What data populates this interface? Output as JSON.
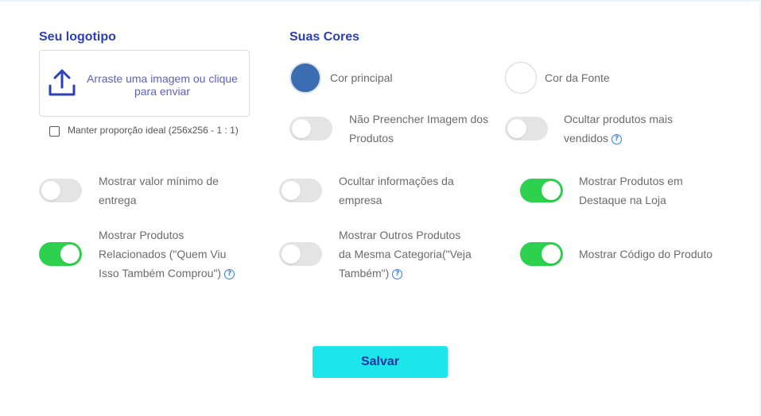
{
  "logo": {
    "heading": "Seu logotipo",
    "upload_text": "Arraste uma imagem ou clique para enviar",
    "keep_ratio_label": "Manter proporção ideal (256x256 - 1 : 1)",
    "keep_ratio_checked": false
  },
  "colors": {
    "heading": "Suas Cores",
    "main_label": "Cor principal",
    "main_color": "#3b6db3",
    "font_label": "Cor da Fonte",
    "font_color": "#ffffff"
  },
  "toggles": {
    "nao_preencher": {
      "line1": "Não Preencher Imagem dos",
      "line2": "Produtos",
      "on": false
    },
    "ocultar_mais_vendidos": {
      "line1": "Ocultar produtos mais",
      "line2": "vendidos",
      "on": false
    },
    "valor_minimo": {
      "line1": "Mostrar valor mínimo de",
      "line2": "entrega",
      "on": false
    },
    "ocultar_empresa": {
      "line1": "Ocultar informações da",
      "line2": "empresa",
      "on": false
    },
    "destaque": {
      "line1": "Mostrar Produtos em",
      "line2": "Destaque na Loja",
      "on": true
    },
    "relacionados": {
      "line1": "Mostrar Produtos",
      "line2": "Relacionados (\"Quem Viu",
      "line3": "Isso Também Comprou\")",
      "on": true
    },
    "outros_categoria": {
      "line1": "Mostrar Outros Produtos",
      "line2": "da Mesma Categoria(\"Veja",
      "line3": "Também\")",
      "on": false
    },
    "codigo": {
      "line1": "Mostrar Código do Produto",
      "on": true
    }
  },
  "help_icon_glyph": "?",
  "save_label": "Salvar",
  "accent_colors": {
    "toggle_on": "#2ed14d",
    "toggle_off": "#e4e4e4",
    "save_button": "#1de6ea",
    "heading": "#2a3fb8",
    "help": "#2d7ef7"
  }
}
